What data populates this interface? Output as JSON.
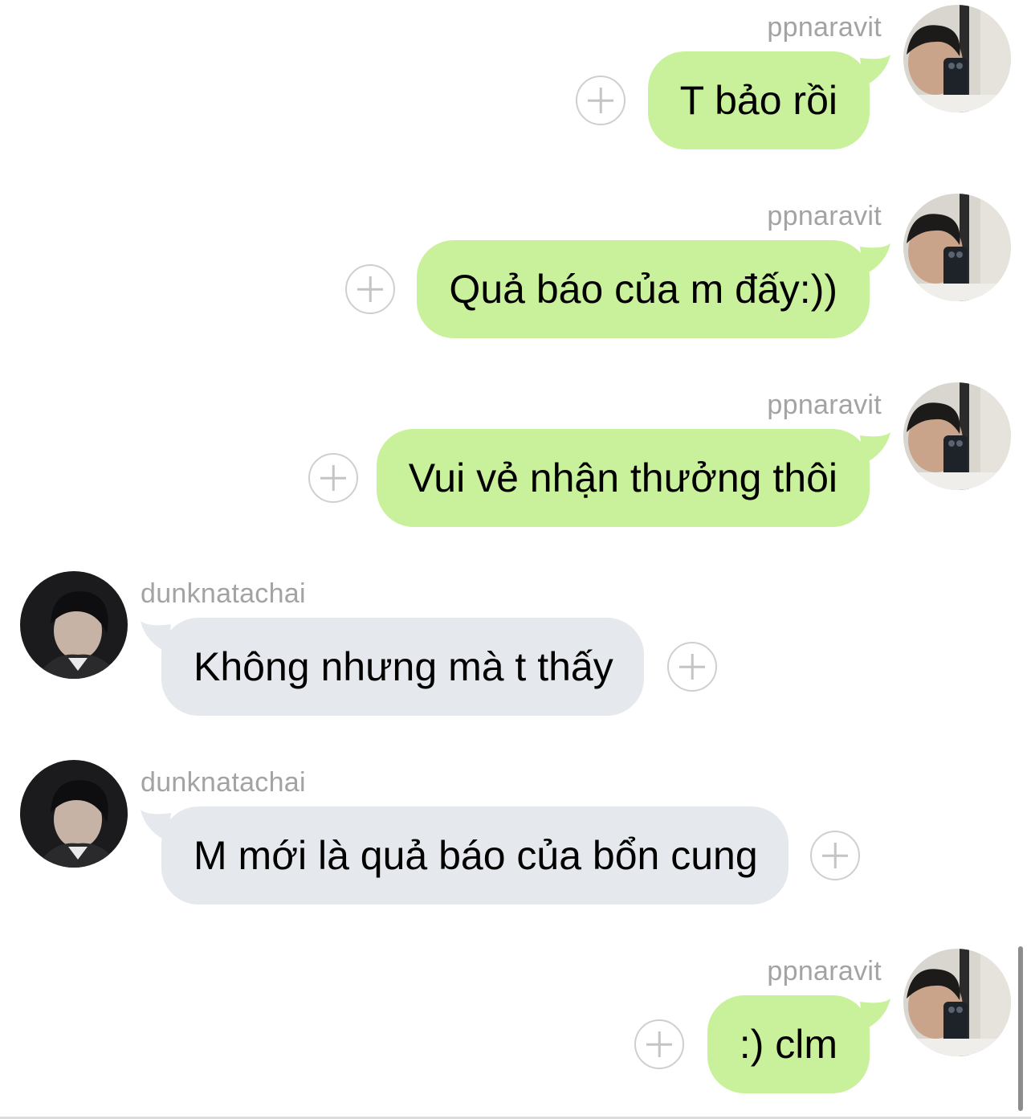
{
  "conversation": {
    "messages": [
      {
        "sender": "ppnaravit",
        "direction": "out",
        "text": "T bảo rồi"
      },
      {
        "sender": "ppnaravit",
        "direction": "out",
        "text": "Quả báo của m đấy:))"
      },
      {
        "sender": "ppnaravit",
        "direction": "out",
        "text": "Vui vẻ nhận thưởng thôi"
      },
      {
        "sender": "dunknatachai",
        "direction": "in",
        "text": "Không nhưng mà t thấy"
      },
      {
        "sender": "dunknatachai",
        "direction": "in",
        "text": "M mới là quả báo của bổn cung"
      },
      {
        "sender": "ppnaravit",
        "direction": "out",
        "text": ":) clm"
      }
    ]
  },
  "icons": {
    "reaction": "plus-circle-icon",
    "avatar_out": "avatar-ppnaravit",
    "avatar_in": "avatar-dunknatachai"
  },
  "colors": {
    "outgoing_bubble": "#c9f09a",
    "incoming_bubble": "#e5e8ec",
    "username": "#a3a3a3",
    "background": "#ffffff"
  }
}
